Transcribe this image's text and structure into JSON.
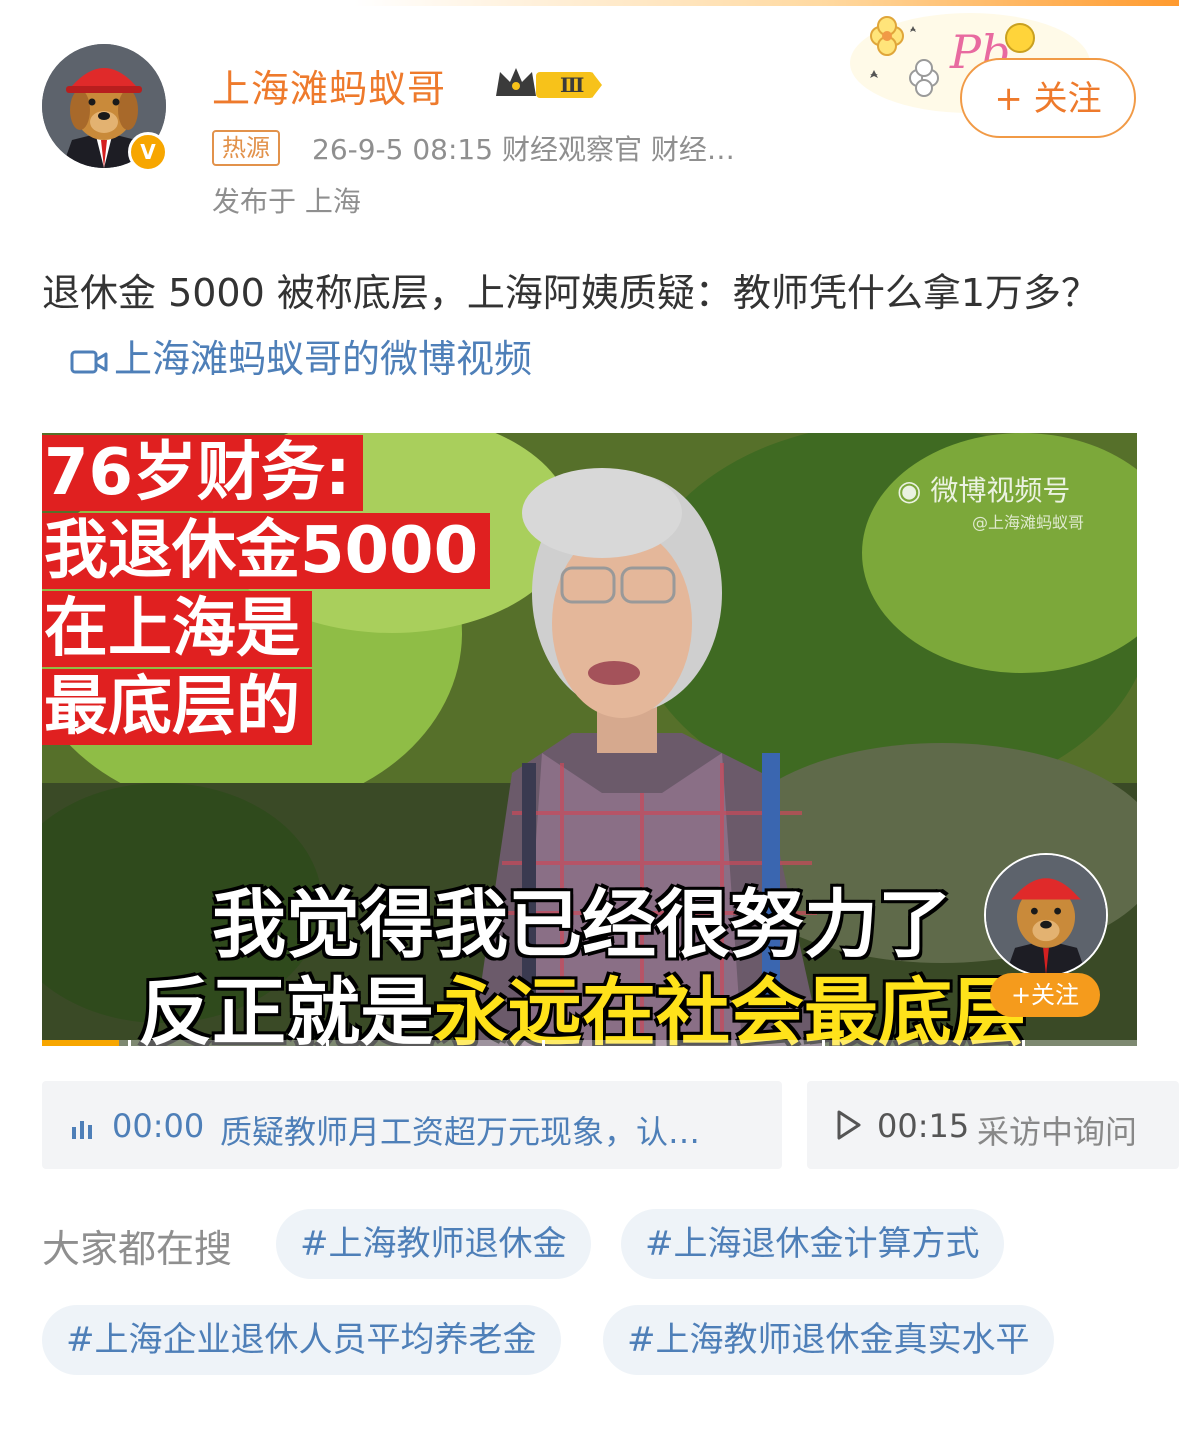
{
  "post": {
    "username": "上海滩蚂蚁哥",
    "level_badge": "Ⅲ",
    "hot_tag": "热源",
    "meta": "26-9-5 08:15  财经观察官 财经…",
    "location": "发布于 上海",
    "follow_label": "+ 关注",
    "text": "退休金 5000 被称底层，上海阿姨质疑：教师凭什么拿1万多？",
    "video_link": "上海滩蚂蚁哥的微博视频"
  },
  "video": {
    "red_caption": [
      "76岁财务:",
      "我退休金5000",
      "在上海是",
      "最底层的"
    ],
    "watermark": "微博视频号",
    "watermark_sub": "@上海滩蚂蚁哥",
    "subtitle_line1": "我觉得我已经很努力了",
    "subtitle_line2_a": "反正就是",
    "subtitle_line2_b": "永远在社会最底层",
    "mini_follow": "+关注",
    "progress": 0.07
  },
  "chapters": [
    {
      "time": "00:00",
      "text": "质疑教师月工资超万元现象，认…"
    },
    {
      "time": "00:15",
      "text": "采访中询问"
    }
  ],
  "search": {
    "label": "大家都在搜",
    "chips": [
      "#上海教师退休金",
      "#上海退休金计算方式",
      "#上海企业退休人员平均养老金",
      "#上海教师退休金真实水平"
    ]
  },
  "colors": {
    "accent": "#ee7a2c",
    "link": "#4e7fb8",
    "gold": "#f7a600",
    "caption_red": "#e02020"
  }
}
